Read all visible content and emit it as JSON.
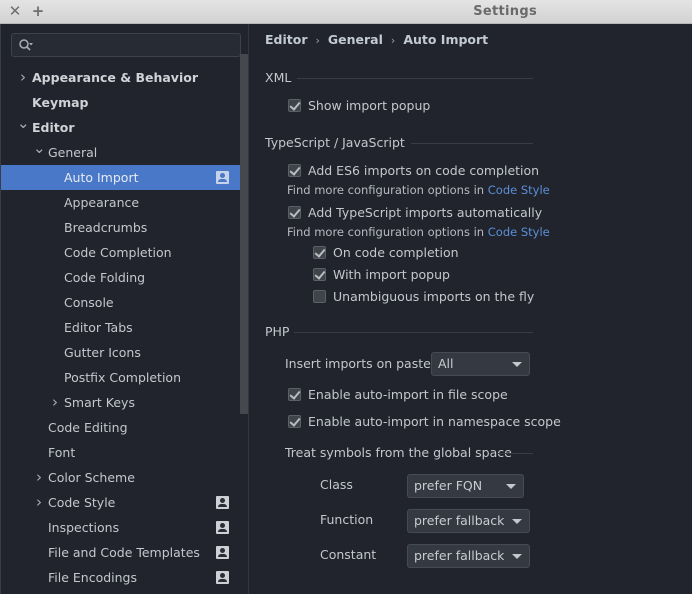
{
  "window": {
    "title": "Settings",
    "close_glyph": "✕",
    "add_glyph": "+"
  },
  "search": {
    "placeholder": "",
    "value": ""
  },
  "tree": [
    {
      "label": "Appearance & Behavior",
      "level": 0,
      "chevron": "right",
      "bold": true
    },
    {
      "label": "Keymap",
      "level": 0,
      "chevron": "none",
      "bold": true
    },
    {
      "label": "Editor",
      "level": 0,
      "chevron": "down",
      "bold": true
    },
    {
      "label": "General",
      "level": 1,
      "chevron": "down"
    },
    {
      "label": "Auto Import",
      "level": 2,
      "chevron": "none",
      "selected": true,
      "project_badge": true
    },
    {
      "label": "Appearance",
      "level": 2,
      "chevron": "none"
    },
    {
      "label": "Breadcrumbs",
      "level": 2,
      "chevron": "none"
    },
    {
      "label": "Code Completion",
      "level": 2,
      "chevron": "none"
    },
    {
      "label": "Code Folding",
      "level": 2,
      "chevron": "none"
    },
    {
      "label": "Console",
      "level": 2,
      "chevron": "none"
    },
    {
      "label": "Editor Tabs",
      "level": 2,
      "chevron": "none"
    },
    {
      "label": "Gutter Icons",
      "level": 2,
      "chevron": "none"
    },
    {
      "label": "Postfix Completion",
      "level": 2,
      "chevron": "none"
    },
    {
      "label": "Smart Keys",
      "level": 2,
      "chevron": "right"
    },
    {
      "label": "Code Editing",
      "level": 1,
      "chevron": "none"
    },
    {
      "label": "Font",
      "level": 1,
      "chevron": "none"
    },
    {
      "label": "Color Scheme",
      "level": 1,
      "chevron": "right"
    },
    {
      "label": "Code Style",
      "level": 1,
      "chevron": "right",
      "project_badge": true
    },
    {
      "label": "Inspections",
      "level": 1,
      "chevron": "none",
      "project_badge": true
    },
    {
      "label": "File and Code Templates",
      "level": 1,
      "chevron": "none",
      "project_badge": true
    },
    {
      "label": "File Encodings",
      "level": 1,
      "chevron": "none",
      "project_badge": true
    }
  ],
  "breadcrumb": {
    "items": [
      "Editor",
      "General",
      "Auto Import"
    ],
    "separator": "›"
  },
  "xml": {
    "title": "XML",
    "show_import_popup": {
      "label": "Show import popup",
      "checked": true
    }
  },
  "ts": {
    "title": "TypeScript / JavaScript",
    "es6": {
      "label": "Add ES6 imports on code completion",
      "checked": true
    },
    "hint1": {
      "text": "Find more configuration options in ",
      "link": "Code Style"
    },
    "ts_auto": {
      "label": "Add TypeScript imports automatically",
      "checked": true
    },
    "hint2": {
      "text": "Find more configuration options in ",
      "link": "Code Style"
    },
    "on_completion": {
      "label": "On code completion",
      "checked": true
    },
    "with_popup": {
      "label": "With import popup",
      "checked": true
    },
    "unambiguous": {
      "label": "Unambiguous imports on the fly",
      "checked": false
    }
  },
  "php": {
    "title": "PHP",
    "insert_on_paste": {
      "label": "Insert imports on paste:",
      "value": "All"
    },
    "file_scope": {
      "label": "Enable auto-import in file scope",
      "checked": true
    },
    "namespace_scope": {
      "label": "Enable auto-import in namespace scope",
      "checked": true
    },
    "global_space": {
      "title": "Treat symbols from the global space",
      "class": {
        "label": "Class",
        "value": "prefer FQN"
      },
      "function": {
        "label": "Function",
        "value": "prefer fallback"
      },
      "constant": {
        "label": "Constant",
        "value": "prefer fallback"
      }
    }
  },
  "colors": {
    "accent": "#4a78c8",
    "link": "#5b8fd8",
    "background": "#21242c"
  }
}
